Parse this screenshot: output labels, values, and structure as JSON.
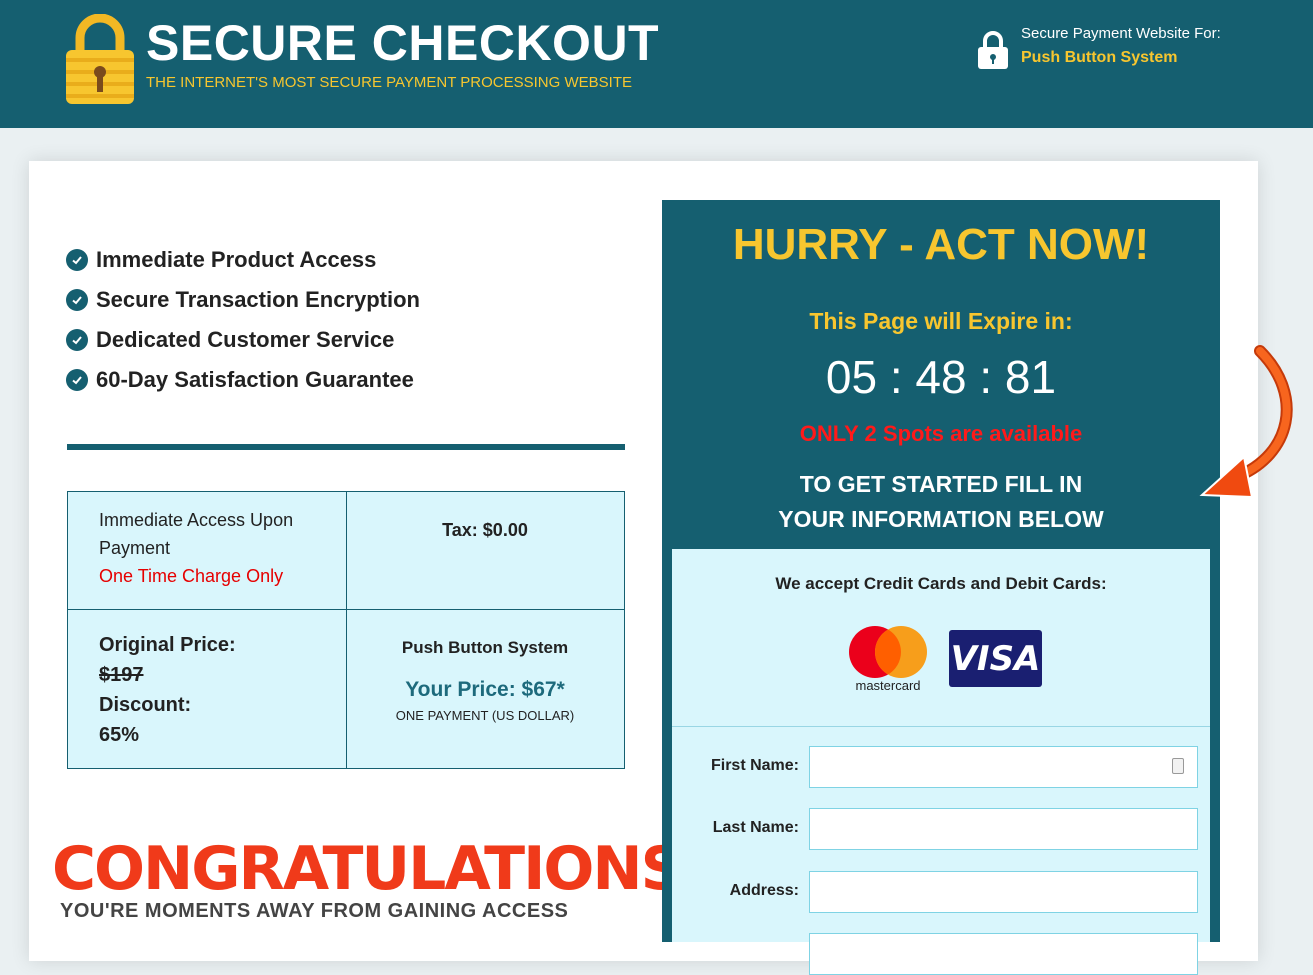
{
  "header": {
    "title": "SECURE CHECKOUT",
    "subtitle": "THE INTERNET'S MOST SECURE PAYMENT PROCESSING WEBSITE",
    "secure_label": "Secure Payment Website For:",
    "secure_name": "Push Button System",
    "logo_icon": "padlock-icon",
    "lock_icon": "lock-icon"
  },
  "features": [
    "Immediate Product Access",
    "Secure Transaction Encryption",
    "Dedicated Customer Service",
    "60-Day Satisfaction Guarantee"
  ],
  "pricing": {
    "access_text": "Immediate Access Upon Payment",
    "charge_text": "One Time Charge Only",
    "tax": "Tax: $0.00",
    "original_label": "Original Price:",
    "original_value": "$197",
    "discount_label": "Discount:",
    "discount_value": "65%",
    "product_name": "Push Button System",
    "your_price": "Your Price: $67*",
    "payment_note": "ONE PAYMENT (US DOLLAR)"
  },
  "congrats": {
    "title": "CONGRATULATIONS!",
    "subtitle": "YOU'RE MOMENTS AWAY FROM GAINING ACCESS"
  },
  "offer": {
    "hurry": "HURRY - ACT NOW!",
    "expire_label": "This Page will Expire in:",
    "timer": "05 : 48 : 81",
    "spots": "ONLY 2 Spots are available",
    "instruction_line1": "TO GET STARTED FILL IN",
    "instruction_line2": "YOUR INFORMATION BELOW"
  },
  "form": {
    "accept_text": "We accept Credit Cards and Debit Cards:",
    "mastercard_label": "mastercard",
    "visa_label": "VISA",
    "fields": [
      {
        "label": "First Name:",
        "value": ""
      },
      {
        "label": "Last Name:",
        "value": ""
      },
      {
        "label": "Address:",
        "value": ""
      }
    ]
  },
  "colors": {
    "brand_teal": "#155f70",
    "accent_yellow": "#f7c62f",
    "light_cyan": "#d9f6fc",
    "alert_red": "#e60000",
    "arrow_orange": "#f04a10"
  }
}
